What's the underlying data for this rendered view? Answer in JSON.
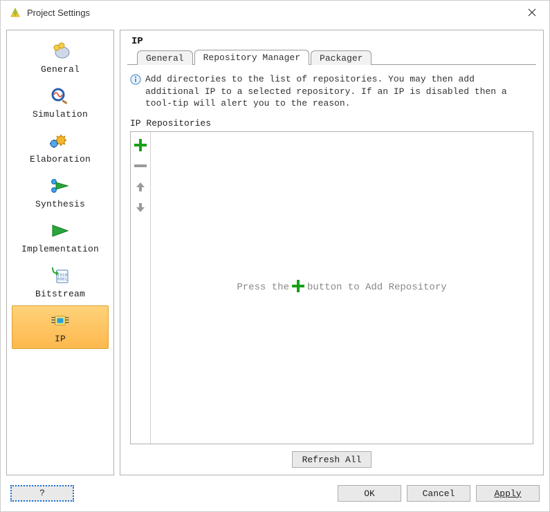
{
  "window": {
    "title": "Project Settings"
  },
  "sidebar": {
    "items": [
      {
        "key": "general",
        "label": "General"
      },
      {
        "key": "simulation",
        "label": "Simulation"
      },
      {
        "key": "elaboration",
        "label": "Elaboration"
      },
      {
        "key": "synthesis",
        "label": "Synthesis"
      },
      {
        "key": "implementation",
        "label": "Implementation"
      },
      {
        "key": "bitstream",
        "label": "Bitstream"
      },
      {
        "key": "ip",
        "label": "IP"
      }
    ],
    "selected": "ip"
  },
  "main": {
    "title": "IP",
    "tabs": [
      {
        "key": "general",
        "label": "General"
      },
      {
        "key": "repository-manager",
        "label": "Repository Manager"
      },
      {
        "key": "packager",
        "label": "Packager"
      }
    ],
    "active_tab": "repository-manager",
    "info_text": "Add directories to the list of repositories. You may then add additional IP to a selected repository. If an IP is disabled then a tool-tip will alert you to the reason.",
    "section_label": "IP Repositories",
    "placeholder_prefix": "Press the ",
    "placeholder_suffix": " button to Add Repository",
    "refresh_label": "Refresh All"
  },
  "footer": {
    "help_label": "?",
    "ok_label": "OK",
    "cancel_label": "Cancel",
    "apply_label": "Apply"
  },
  "colors": {
    "accent_orange": "#fdb84d",
    "plus_green": "#18a018",
    "disabled_grey": "#9a9a9a"
  }
}
